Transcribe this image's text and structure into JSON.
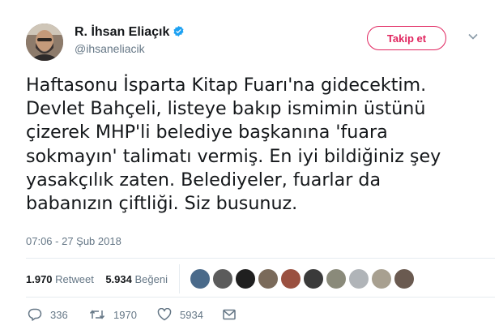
{
  "user": {
    "name": "R. İhsan Eliaçık",
    "handle": "@ihsaneliacik"
  },
  "follow_label": "Takip et",
  "tweet_text": "Haftasonu İsparta Kitap Fuarı'na gidecektim.\nDevlet Bahçeli, listeye bakıp ismimin üstünü\nçizerek MHP'li belediye başkanına 'fuara\nsokmayın' talimatı vermiş. En iyi bildiğiniz şey\nyasakçılık zaten. Belediyeler, fuarlar da\nbabanızın çiftliği. Siz busunuz.",
  "timestamp": "07:06 - 27 Şub 2018",
  "stats": {
    "retweet_count": "1.970",
    "retweet_label": "Retweet",
    "like_count": "5.934",
    "like_label": "Beğeni"
  },
  "actions": {
    "reply_count": "336",
    "retweet_count": "1970",
    "like_count": "5934"
  },
  "colors": {
    "accent": "#e0245e",
    "verified": "#1da1f2",
    "muted": "#657786"
  },
  "icons": [
    "verified-badge-icon",
    "chevron-down-icon",
    "reply-icon",
    "retweet-icon",
    "heart-icon",
    "message-icon"
  ]
}
